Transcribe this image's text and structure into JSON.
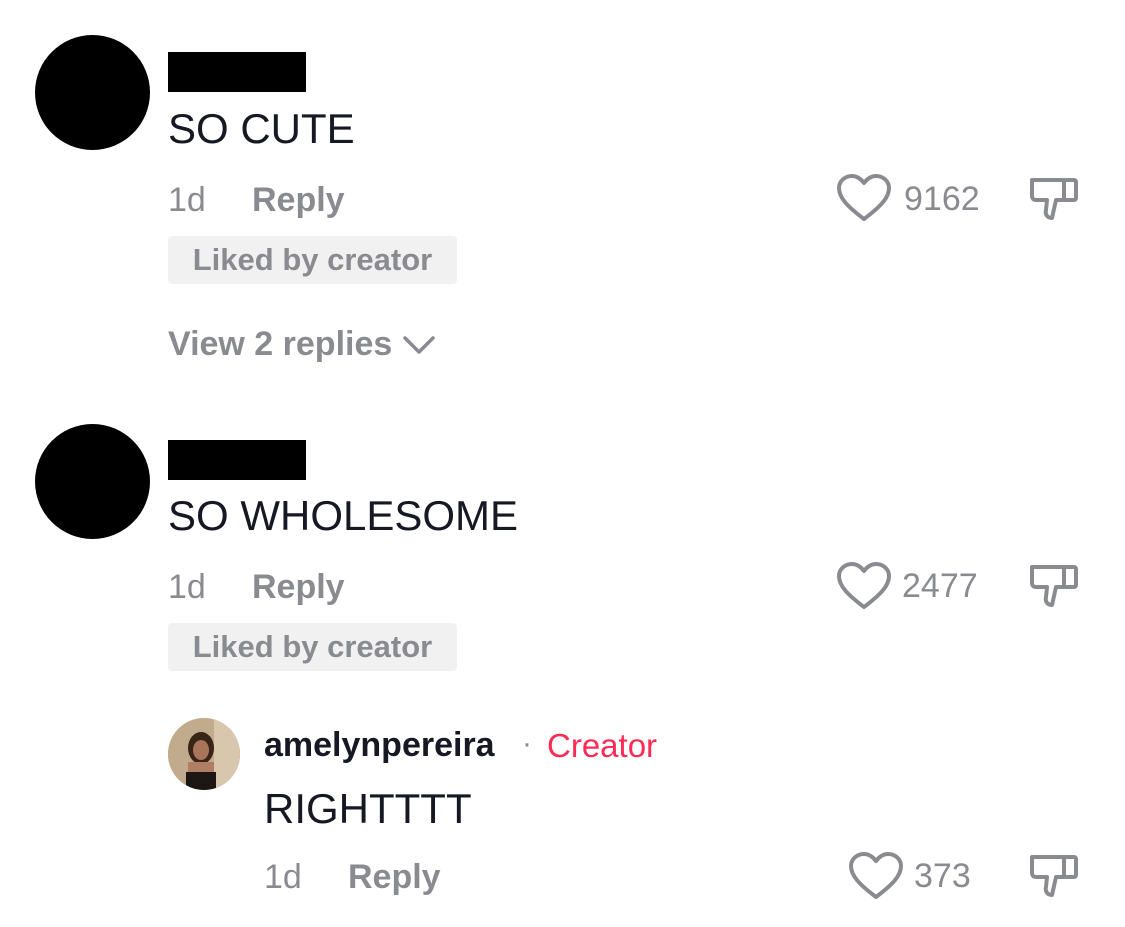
{
  "comments": [
    {
      "text": "SO CUTE",
      "time": "1d",
      "reply_label": "Reply",
      "likes": "9162",
      "liked_badge": "Liked by creator",
      "view_replies": "View 2 replies"
    },
    {
      "text": "SO WHOLESOME",
      "time": "1d",
      "reply_label": "Reply",
      "likes": "2477",
      "liked_badge": "Liked by creator",
      "reply": {
        "username": "amelynpereira",
        "separator": "·",
        "creator_label": "Creator",
        "text": "RIGHTTTT",
        "time": "1d",
        "reply_label": "Reply",
        "likes": "373"
      }
    }
  ],
  "colors": {
    "text": "#161823",
    "muted": "#8a8b91",
    "creator": "#fe2c55",
    "badge_bg": "#f1f1f2"
  },
  "icons": [
    "heart-icon",
    "dislike-icon",
    "chevron-down-icon"
  ]
}
